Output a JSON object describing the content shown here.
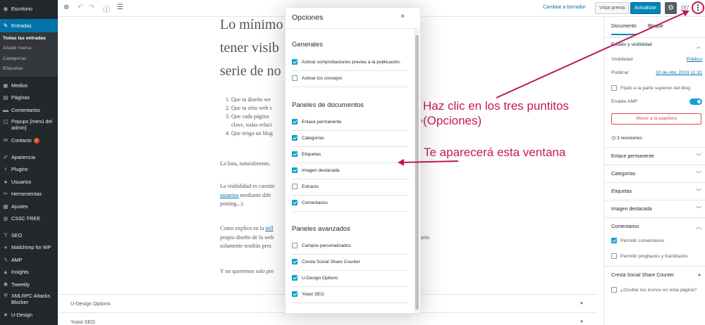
{
  "sidebar": {
    "items_top": [
      {
        "label": "Escritorio",
        "icon": "dashboard-icon"
      }
    ],
    "active": {
      "label": "Entradas",
      "icon": "pin-icon"
    },
    "submenu": [
      "Todas las entradas",
      "Añadir nueva",
      "Categorías",
      "Etiquetas"
    ],
    "items": [
      {
        "label": "Medios",
        "icon": "media-icon"
      },
      {
        "label": "Páginas",
        "icon": "page-icon"
      },
      {
        "label": "Comentarios",
        "icon": "comment-icon"
      }
    ],
    "popups": {
      "label": "Popups [menú del admin]",
      "icon": "popup-icon"
    },
    "contacto": {
      "label": "Contacto",
      "badge": "1",
      "icon": "mail-icon"
    },
    "items2": [
      {
        "label": "Apariencia",
        "icon": "brush-icon"
      },
      {
        "label": "Plugins",
        "icon": "plugin-icon"
      },
      {
        "label": "Usuarios",
        "icon": "user-icon"
      },
      {
        "label": "Herramientas",
        "icon": "wrench-icon"
      },
      {
        "label": "Ajustes",
        "icon": "settings-icon"
      },
      {
        "label": "CSSC FREE",
        "icon": "cssc-icon"
      }
    ],
    "items3": [
      {
        "label": "SEO",
        "icon": "yoast-icon"
      },
      {
        "label": "Mailchimp for WP",
        "icon": "mailchimp-icon"
      },
      {
        "label": "AMP",
        "icon": "amp-icon"
      },
      {
        "label": "Insights",
        "icon": "insights-icon"
      },
      {
        "label": "Tweetily",
        "icon": "twitter-icon"
      }
    ],
    "xmlrpc": {
      "label": "XMLRPC Attacks Blocker",
      "icon": "shield-icon"
    },
    "udesign": {
      "label": "U-Design",
      "icon": "star-icon"
    }
  },
  "topbar": {
    "switch_draft": "Cambiar a borrador",
    "preview": "Vista previa",
    "update": "Actualizar",
    "more_icon": "⋮"
  },
  "editor": {
    "heading_line1": "Lo mínimo",
    "heading_line1_tail": "t",
    "heading_line2": "tener visib",
    "heading_line3": "serie de no",
    "list": [
      "Que tu diseño we",
      "Que tu sitio web s",
      "Que cada página",
      "clave, todas relaci",
      "Que tenga un blog"
    ],
    "list_tail": "s",
    "para1": "La lista, naturalmente,",
    "para2_a": "La visibilidad es cuestió",
    "para2_link": "usuarios",
    "para2_b": "mediante dife",
    "para2_c": "posting...).",
    "para3_a": "Como explico en la",
    "para3_link": "infl",
    "para3_b": "propio diseño de la web",
    "para3_tail": "rario",
    "para3_c": "solamente tendrás pres",
    "para4": "Y no queremos solo pre",
    "meta_boxes": [
      "U-Design Options",
      "Yoast SEO"
    ]
  },
  "settings": {
    "tab_document": "Documento",
    "tab_block": "Bloque",
    "status_title": "Estado y visibilidad",
    "visibility_label": "Visibilidad",
    "visibility_value": "Público",
    "publish_label": "Publicar",
    "publish_value": "10 de Abr, 2019 11:31",
    "stick_label": "Fíjalo a la parte superior del blog",
    "amp_label": "Enable AMP",
    "trash_label": "Mover a la papelera",
    "revisions": "3 revisiones",
    "panels": [
      "Enlace permanente",
      "Categorías",
      "Etiquetas",
      "Imagen destacada"
    ],
    "comments_title": "Comentarios",
    "allow_comments": "Permitir comentarios",
    "allow_pingbacks": "Permitir pingbacks y trackbacks",
    "cresta_title": "Cresta Social Share Counter",
    "cresta_hide": "¿Ocultar los iconos en esta página?"
  },
  "modal": {
    "title": "Opciones",
    "close_icon": "×",
    "general_title": "Generales",
    "general": [
      {
        "label": "Activar comprobaciones previas a la publicación.",
        "checked": true
      },
      {
        "label": "Activar los consejos",
        "checked": false
      }
    ],
    "documents_title": "Paneles de documentos",
    "documents": [
      {
        "label": "Enlace permanente",
        "checked": true
      },
      {
        "label": "Categorías",
        "checked": true
      },
      {
        "label": "Etiquetas",
        "checked": true
      },
      {
        "label": "Imagen destacada",
        "checked": true
      },
      {
        "label": "Extracto",
        "checked": false
      },
      {
        "label": "Comentarios",
        "checked": true
      }
    ],
    "advanced_title": "Paneles avanzados",
    "advanced": [
      {
        "label": "Campos personalizados",
        "checked": false
      },
      {
        "label": "Cresta Social Share Counter",
        "checked": true
      },
      {
        "label": "U-Design Options",
        "checked": true
      },
      {
        "label": "Yoast SEO",
        "checked": true
      }
    ]
  },
  "annotations": {
    "line1": "Haz clic en los tres puntitos",
    "line2": "(Opciones)",
    "line3": "Te aparecerá esta ventana",
    "color": "#c2185b"
  }
}
